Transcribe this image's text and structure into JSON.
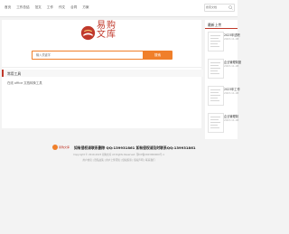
{
  "nav": {
    "items": [
      "首页",
      "工作总结",
      "范文",
      "工作",
      "作文",
      "合同",
      "方案"
    ],
    "search_placeholder": "搜索文档"
  },
  "logo": {
    "line1": "易购",
    "line2": "文库"
  },
  "main_search": {
    "placeholder": "输入关键字",
    "button_label": "搜索"
  },
  "section": {
    "title": "常用工具",
    "line": "在线 office 文档转换工具"
  },
  "sidebar": {
    "title": "最新上传",
    "items": [
      {
        "title": "2023年述职",
        "date": "2023-11-08"
      },
      {
        "title": "企业管理制度",
        "date": "2023-11-08"
      },
      {
        "title": "2023年工作",
        "date": "2023-11-08"
      },
      {
        "title": "企业管理制",
        "date": "2023-11-08"
      }
    ]
  },
  "footer": {
    "logo_text": "易购文库",
    "contact_line": "如有侵权请联系删除 QQ:139931861     如有侵权请及时联系QQ:139931861",
    "copyright": "Copyright © 2019-2023 易购文库 All Rights Reserved. 鄂ICP备2023000000号-1",
    "icp_link": "鄂ICP备2023000000号-1",
    "bottom_links": "用户协议 | 隐私政策 | 用户上传须知 | 侵权投诉 | 版权声明 | 联系我们"
  },
  "colors": {
    "accent": "#c0392b",
    "button": "#f07f2a"
  }
}
